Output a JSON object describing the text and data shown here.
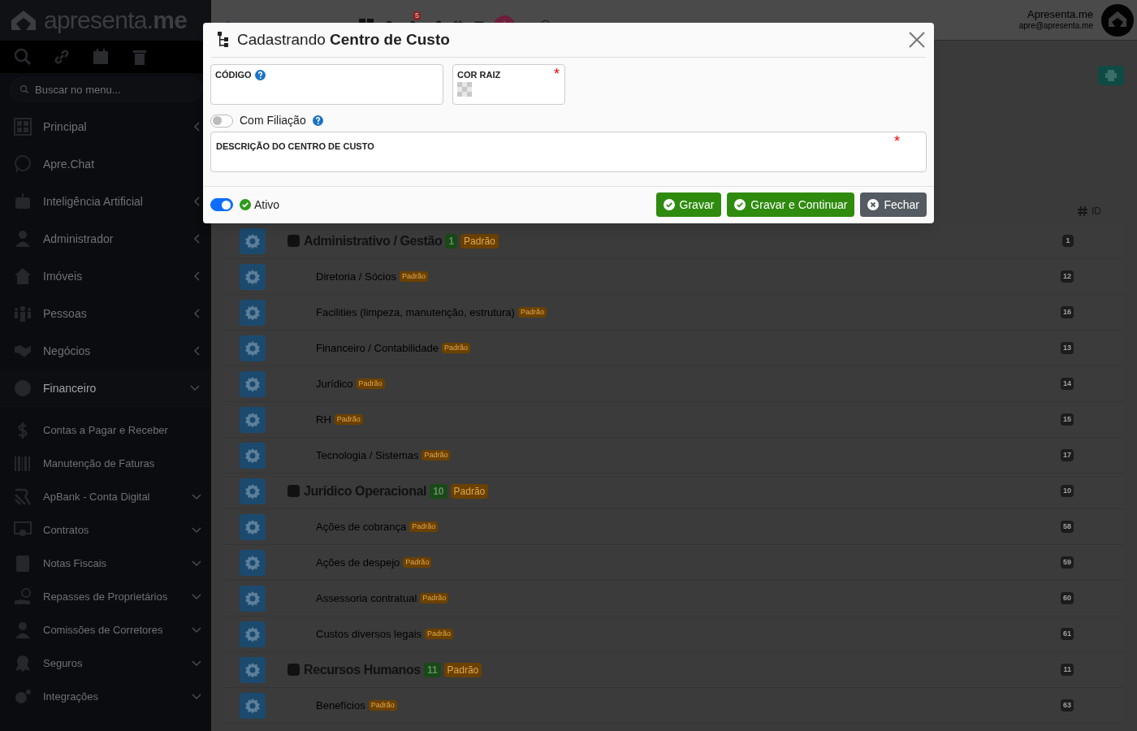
{
  "sidebar": {
    "logo": "apresenta.**me**",
    "search": {
      "placeholder": "Buscar no menu..."
    },
    "items": [
      {
        "label": "Principal",
        "expandable": true,
        "expanded": false
      },
      {
        "label": "Apre.Chat",
        "expandable": false,
        "expanded": false
      },
      {
        "label": "Inteligência Artificial",
        "expandable": true,
        "expanded": false
      },
      {
        "label": "Administrador",
        "expandable": true,
        "expanded": false
      },
      {
        "label": "Imóveis",
        "expandable": true,
        "expanded": false
      },
      {
        "label": "Pessoas",
        "expandable": true,
        "expanded": false
      },
      {
        "label": "Negócios",
        "expandable": true,
        "expanded": false
      },
      {
        "label": "Financeiro",
        "expandable": true,
        "expanded": true,
        "children": [
          {
            "label": "Contas a Pagar e Receber",
            "expandable": false
          },
          {
            "label": "Manutenção de Faturas",
            "expandable": false
          },
          {
            "label": "ApBank - Conta Digital",
            "expandable": true,
            "expanded": false
          },
          {
            "label": "Contratos",
            "expandable": true,
            "expanded": false
          },
          {
            "label": "Notas Fiscais",
            "expandable": true,
            "expanded": false
          },
          {
            "label": "Repasses de Proprietários",
            "expandable": true,
            "expanded": false
          },
          {
            "label": "Comissões de Corretores",
            "expandable": true,
            "expanded": false
          },
          {
            "label": "Seguros",
            "expandable": true,
            "expanded": false
          },
          {
            "label": "Integrações",
            "expandable": true,
            "expanded": false
          }
        ]
      }
    ]
  },
  "header": {
    "notification_badge": "5",
    "user": {
      "name": "Apresenta.me",
      "email": "apre@apresenta.me"
    }
  },
  "table": {
    "id_column": "ID",
    "rows": [
      {
        "kind": "group",
        "name": "Administrativo / Gestão",
        "count": "1",
        "tag": "Padrão",
        "id": "1",
        "color": "#111111"
      },
      {
        "kind": "child",
        "name": "Diretoria / Sócios",
        "tag": "Padrão",
        "id": "12"
      },
      {
        "kind": "child",
        "name": "Facilities (limpeza, manutenção, estrutura)",
        "tag": "Padrão",
        "id": "16"
      },
      {
        "kind": "child",
        "name": "Financeiro / Contabilidade",
        "tag": "Padrão",
        "id": "13"
      },
      {
        "kind": "child",
        "name": "Jurídico",
        "tag": "Padrão",
        "id": "14"
      },
      {
        "kind": "child",
        "name": "RH",
        "tag": "Padrão",
        "id": "15"
      },
      {
        "kind": "child",
        "name": "Tecnologia / Sistemas",
        "tag": "Padrão",
        "id": "17"
      },
      {
        "kind": "group",
        "name": "Jurídico Operacional",
        "count": "10",
        "tag": "Padrão",
        "id": "10",
        "color": "#111111"
      },
      {
        "kind": "child",
        "name": "Ações de cobrança",
        "tag": "Padrão",
        "id": "58"
      },
      {
        "kind": "child",
        "name": "Ações de despejo",
        "tag": "Padrão",
        "id": "59"
      },
      {
        "kind": "child",
        "name": "Assessoria contratual",
        "tag": "Padrão",
        "id": "60"
      },
      {
        "kind": "child",
        "name": "Custos diversos legais",
        "tag": "Padrão",
        "id": "61"
      },
      {
        "kind": "group",
        "name": "Recursos Humanos",
        "count": "11",
        "tag": "Padrão",
        "id": "11",
        "color": "#111111"
      },
      {
        "kind": "child",
        "name": "Benefícios",
        "tag": "Padrão",
        "id": "63"
      }
    ]
  },
  "modal": {
    "title": "Cadastrando **Centro de Custo**",
    "fields": [
      {
        "kind": "text",
        "label": "CÓDIGO",
        "help": true
      },
      {
        "kind": "color",
        "label": "COR RAIZ",
        "help": false,
        "required_mark": "*"
      }
    ],
    "filiacao": {
      "label": "Com Filiação",
      "on": false,
      "help": true
    },
    "description": {
      "label": "DESCRIÇÃO DO CENTRO DE CUSTO",
      "required_mark": "*"
    },
    "active": {
      "label": "Ativo",
      "on": true
    },
    "buttons": [
      {
        "kind": "save",
        "label": "Gravar"
      },
      {
        "kind": "save",
        "label": "Gravar e Continuar"
      },
      {
        "kind": "close",
        "label": "Fechar"
      }
    ]
  }
}
